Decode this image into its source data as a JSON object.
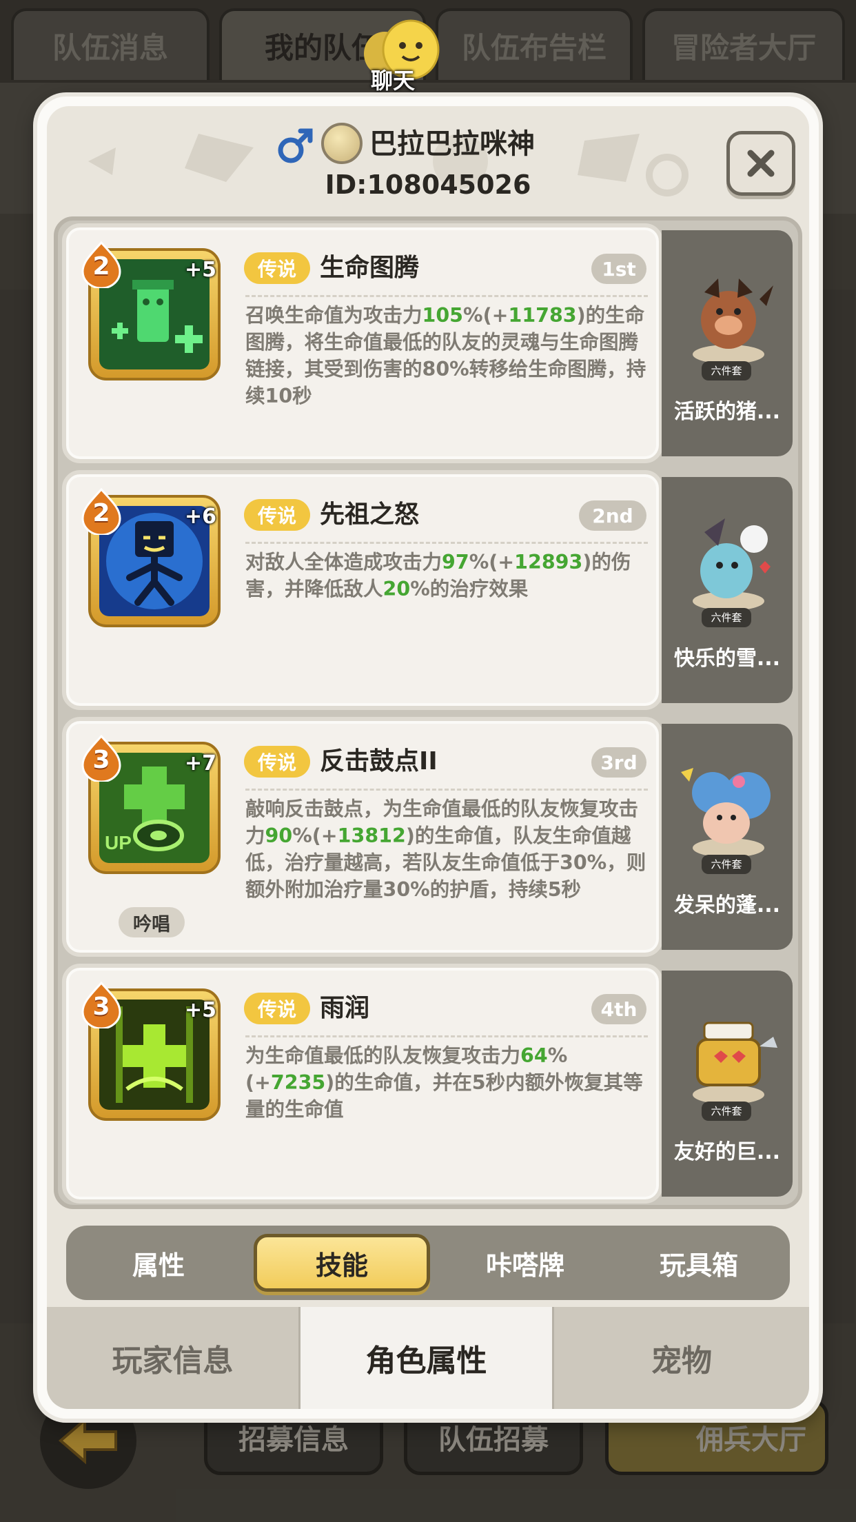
{
  "background": {
    "tabs": [
      "队伍消息",
      "我的队伍",
      "队伍布告栏",
      "冒险者大厅"
    ],
    "chat_label": "聊天",
    "bottom_buttons": [
      "招募信息",
      "队伍招募",
      "佣兵大厅"
    ]
  },
  "player": {
    "name": "巴拉巴拉咪神",
    "id": "ID:108045026"
  },
  "skills": [
    {
      "level": "2",
      "bonus": "+5",
      "rarity": "传说",
      "title": "生命图腾",
      "rank": "1st",
      "desc_parts": [
        "召唤生命值为攻击力",
        "105",
        "%(+",
        "11783",
        ")的生命图腾，将生命值最低的队友的灵魂与生命图腾链接，其受到伤害的80%转移给生命图腾，持续10秒"
      ],
      "pet_set": "六件套",
      "pet_name": "活跃的猪..."
    },
    {
      "level": "2",
      "bonus": "+6",
      "rarity": "传说",
      "title": "先祖之怒",
      "rank": "2nd",
      "desc_parts": [
        "对敌人全体造成攻击力",
        "97",
        "%(+",
        "12893",
        ")的伤害，并降低敌人",
        "20",
        "%的治疗效果"
      ],
      "pet_set": "六件套",
      "pet_name": "快乐的雪..."
    },
    {
      "level": "3",
      "bonus": "+7",
      "rarity": "传说",
      "title": "反击鼓点II",
      "rank": "3rd",
      "tag": "吟唱",
      "desc_parts": [
        "敲响反击鼓点，为生命值最低的队友恢复攻击力",
        "90",
        "%(+",
        "13812",
        ")的生命值，队友生命值越低，治疗量越高，若队友生命值低于30%，则额外附加治疗量30%的护盾，持续5秒"
      ],
      "pet_set": "六件套",
      "pet_name": "发呆的蓬..."
    },
    {
      "level": "3",
      "bonus": "+5",
      "rarity": "传说",
      "title": "雨润",
      "rank": "4th",
      "desc_parts": [
        "为生命值最低的队友恢复攻击力",
        "64",
        "%(+",
        "7235",
        ")的生命值，并在5秒内额外恢复其等量的生命值"
      ],
      "pet_set": "六件套",
      "pet_name": "友好的巨..."
    }
  ],
  "sub_tabs": [
    "属性",
    "技能",
    "咔嗒牌",
    "玩具箱"
  ],
  "sub_tab_active": "技能",
  "main_tabs": [
    "玩家信息",
    "角色属性",
    "宠物"
  ],
  "main_tab_active": "角色属性",
  "colors": {
    "highlight_green": "#45a632",
    "legend_gold": "#f2c640",
    "panel_brown": "#6d6a62"
  }
}
